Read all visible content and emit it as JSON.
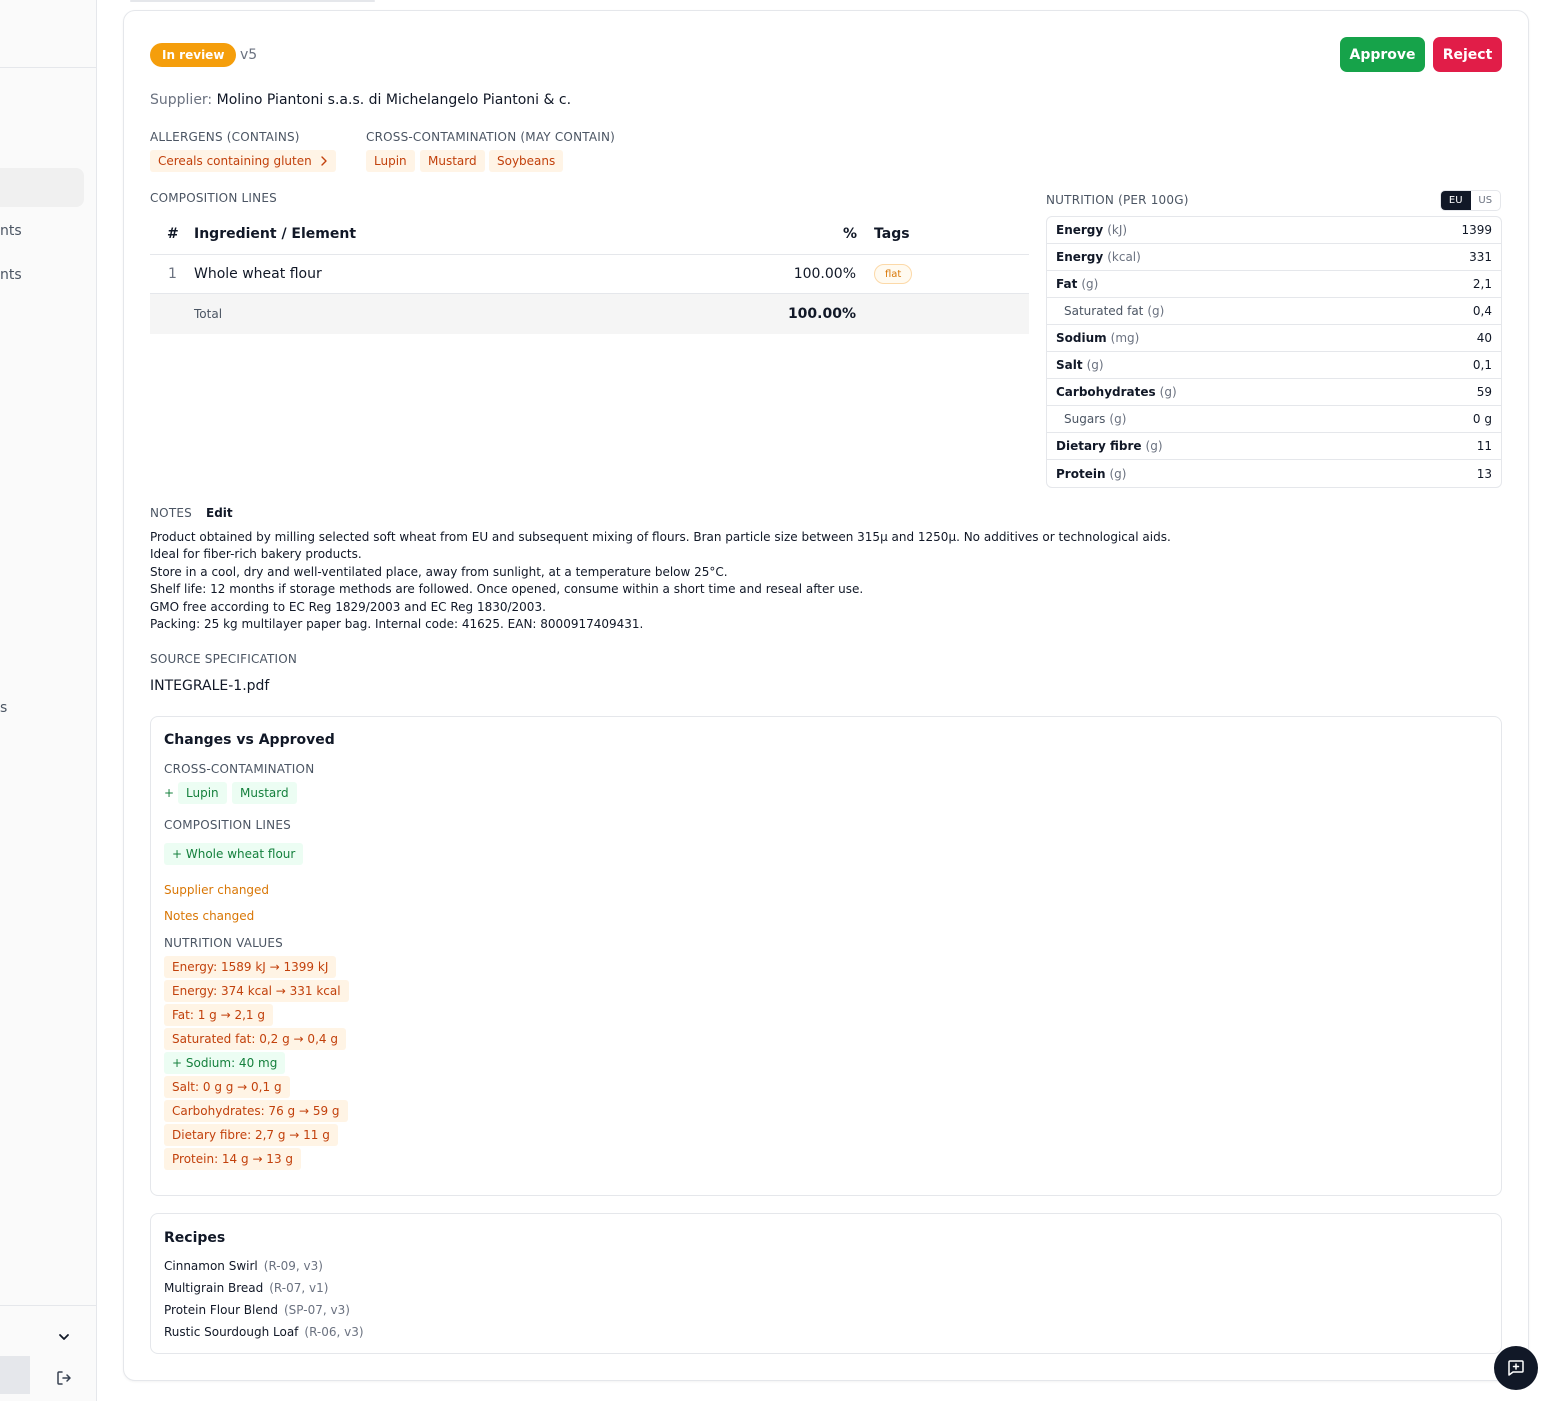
{
  "sidebar": {
    "fragments": [
      "nts",
      "nts",
      "s"
    ]
  },
  "header": {
    "status": "In review",
    "version": "v5",
    "approve_label": "Approve",
    "reject_label": "Reject",
    "supplier_label": "Supplier:",
    "supplier_name": "Molino Piantoni s.a.s. di Michelangelo Piantoni & c."
  },
  "allergens": {
    "label": "ALLERGENS (CONTAINS)",
    "items": [
      "Cereals containing gluten"
    ]
  },
  "cross_contamination": {
    "label": "CROSS-CONTAMINATION (MAY CONTAIN)",
    "items": [
      "Lupin",
      "Mustard",
      "Soybeans"
    ]
  },
  "composition": {
    "label": "COMPOSITION LINES",
    "headers": {
      "num": "#",
      "ingredient": "Ingredient / Element",
      "pct": "%",
      "tags": "Tags"
    },
    "rows": [
      {
        "num": "1",
        "ingredient": "Whole wheat flour",
        "pct": "100.00%",
        "tag": "flat"
      }
    ],
    "total_label": "Total",
    "total_value": "100.00%"
  },
  "nutrition": {
    "label": "NUTRITION (PER 100G)",
    "toggle": {
      "eu": "EU",
      "us": "US",
      "selected": "EU"
    },
    "rows": [
      {
        "name": "Energy",
        "unit": "(kJ)",
        "value": "1399",
        "sub": false
      },
      {
        "name": "Energy",
        "unit": "(kcal)",
        "value": "331",
        "sub": false
      },
      {
        "name": "Fat",
        "unit": "(g)",
        "value": "2,1",
        "sub": false
      },
      {
        "name": "Saturated fat",
        "unit": "(g)",
        "value": "0,4",
        "sub": true
      },
      {
        "name": "Sodium",
        "unit": "(mg)",
        "value": "40",
        "sub": false
      },
      {
        "name": "Salt",
        "unit": "(g)",
        "value": "0,1",
        "sub": false
      },
      {
        "name": "Carbohydrates",
        "unit": "(g)",
        "value": "59",
        "sub": false
      },
      {
        "name": "Sugars",
        "unit": "(g)",
        "value": "0 g",
        "sub": true
      },
      {
        "name": "Dietary fibre",
        "unit": "(g)",
        "value": "11",
        "sub": false
      },
      {
        "name": "Protein",
        "unit": "(g)",
        "value": "13",
        "sub": false
      }
    ]
  },
  "notes": {
    "label": "NOTES",
    "edit_label": "Edit",
    "lines": [
      "Product obtained by milling selected soft wheat from EU and subsequent mixing of flours. Bran particle size between 315μ and 1250μ. No additives or technological aids.",
      "Ideal for fiber-rich bakery products.",
      "Store in a cool, dry and well-ventilated place, away from sunlight, at a temperature below 25°C.",
      "Shelf life: 12 months if storage methods are followed. Once opened, consume within a short time and reseal after use.",
      "GMO free according to EC Reg 1829/2003 and EC Reg 1830/2003.",
      "Packing: 25 kg multilayer paper bag. Internal code: 41625. EAN: 8000917409431."
    ]
  },
  "source": {
    "label": "SOURCE SPECIFICATION",
    "file": "INTEGRALE-1.pdf"
  },
  "changes": {
    "title": "Changes vs Approved",
    "cross_label": "CROSS-CONTAMINATION",
    "cross_plus": "+",
    "cross_items": [
      "Lupin",
      "Mustard"
    ],
    "composition_label": "COMPOSITION LINES",
    "composition_items": [
      "+ Whole wheat flour"
    ],
    "supplier_changed": "Supplier changed",
    "notes_changed": "Notes changed",
    "nutrition_label": "NUTRITION VALUES",
    "nutrition_items": [
      {
        "text": "Energy: 1589 kJ → 1399 kJ",
        "kind": "changed"
      },
      {
        "text": "Energy: 374 kcal → 331 kcal",
        "kind": "changed"
      },
      {
        "text": "Fat: 1 g → 2,1 g",
        "kind": "changed"
      },
      {
        "text": "Saturated fat: 0,2 g → 0,4 g",
        "kind": "changed"
      },
      {
        "text": "+ Sodium: 40 mg",
        "kind": "added"
      },
      {
        "text": "Salt: 0 g g → 0,1 g",
        "kind": "changed"
      },
      {
        "text": "Carbohydrates: 76 g → 59 g",
        "kind": "changed"
      },
      {
        "text": "Dietary fibre: 2,7 g → 11 g",
        "kind": "changed"
      },
      {
        "text": "Protein: 14 g → 13 g",
        "kind": "changed"
      }
    ]
  },
  "recipes": {
    "title": "Recipes",
    "items": [
      {
        "name": "Cinnamon Swirl",
        "code": "(R-09, v3)"
      },
      {
        "name": "Multigrain Bread",
        "code": "(R-07, v1)"
      },
      {
        "name": "Protein Flour Blend",
        "code": "(SP-07, v3)"
      },
      {
        "name": "Rustic Sourdough Loaf",
        "code": "(R-06, v3)"
      }
    ]
  },
  "colors": {
    "approve": "#16a34a",
    "reject": "#e11d48",
    "in_review": "#f59e0b",
    "added_green": "#15803d",
    "changed_orange": "#c2410c"
  },
  "icons": {
    "chevron": "chevron-down-icon",
    "logout": "logout-icon",
    "feedback": "message-plus-icon",
    "allergen_chevron": "chevron-right-icon"
  }
}
